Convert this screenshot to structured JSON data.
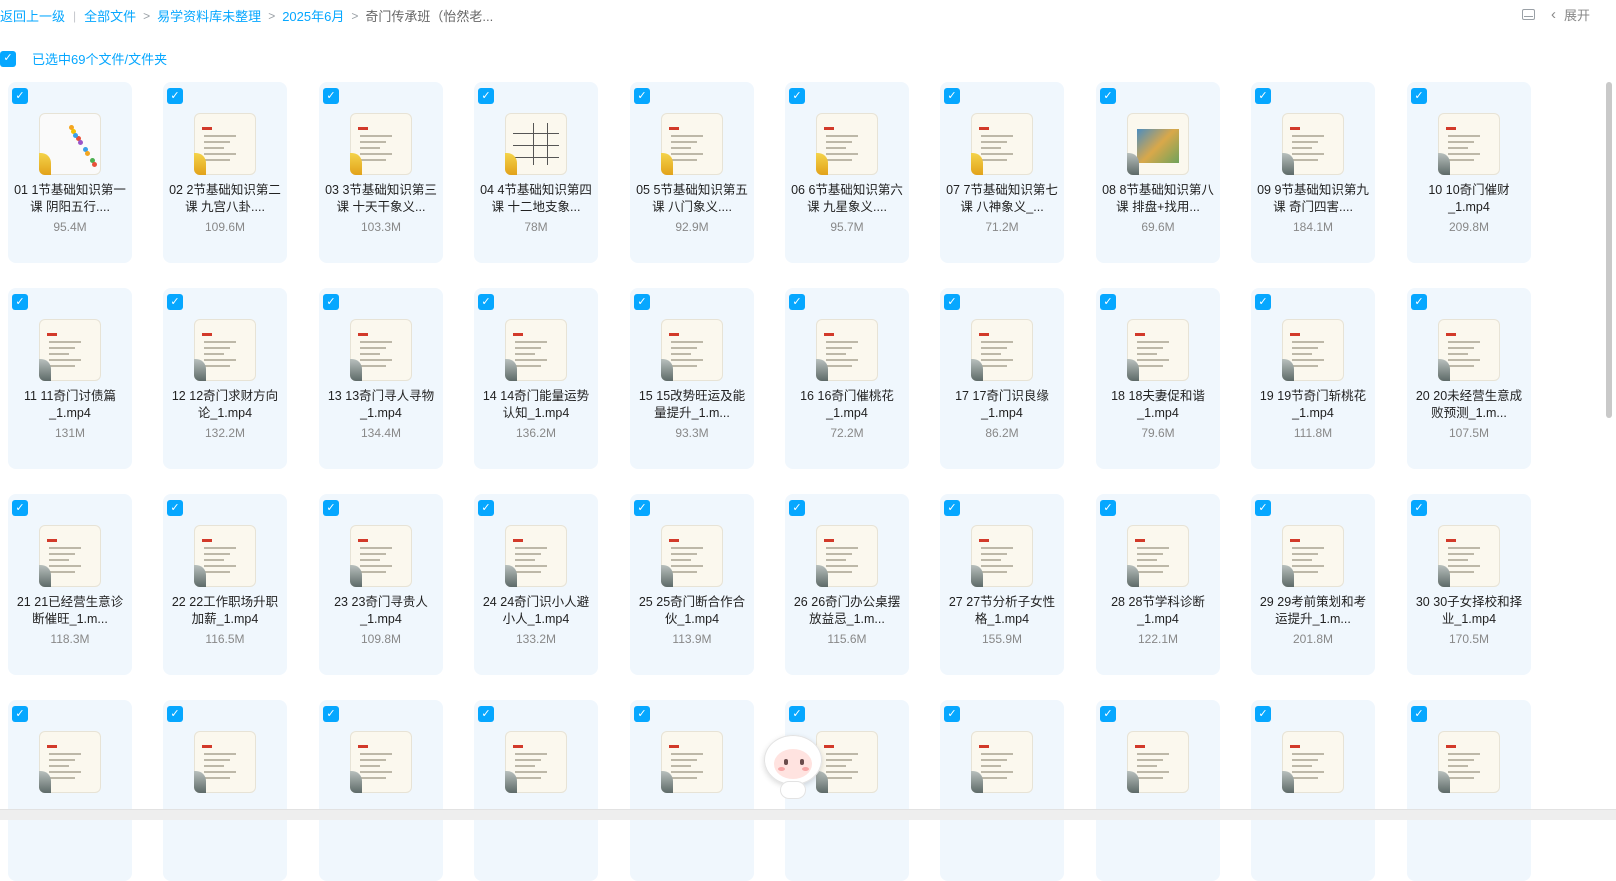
{
  "breadcrumb": {
    "back": "返回上一级",
    "root": "全部文件",
    "items": [
      "易学资料库未整理",
      "2025年6月"
    ],
    "current": "奇门传承班（怡然老..."
  },
  "toolbar": {
    "expand_label": "展开"
  },
  "selection": {
    "text": "已选中69个文件/文件夹"
  },
  "colors": {
    "accent": "#06a7ff",
    "card_bg": "#f0f7fd"
  },
  "files": [
    {
      "name": "01 1节基础知识第一课 阴阳五行....",
      "size": "95.4M"
    },
    {
      "name": "02 2节基础知识第二课 九宫八卦....",
      "size": "109.6M"
    },
    {
      "name": "03 3节基础知识第三课 十天干象义...",
      "size": "103.3M"
    },
    {
      "name": "04 4节基础知识第四课 十二地支象...",
      "size": "78M"
    },
    {
      "name": "05 5节基础知识第五课 八门象义....",
      "size": "92.9M"
    },
    {
      "name": "06 6节基础知识第六课 九星象义....",
      "size": "95.7M"
    },
    {
      "name": "07 7节基础知识第七课 八神象义_...",
      "size": "71.2M"
    },
    {
      "name": "08 8节基础知识第八课 排盘+找用...",
      "size": "69.6M"
    },
    {
      "name": "09 9节基础知识第九课 奇门四害....",
      "size": "184.1M"
    },
    {
      "name": "10 10奇门催财_1.mp4",
      "size": "209.8M"
    },
    {
      "name": "11 11奇门讨债篇_1.mp4",
      "size": "131M"
    },
    {
      "name": "12 12奇门求财方向论_1.mp4",
      "size": "132.2M"
    },
    {
      "name": "13 13奇门寻人寻物_1.mp4",
      "size": "134.4M"
    },
    {
      "name": "14 14奇门能量运势认知_1.mp4",
      "size": "136.2M"
    },
    {
      "name": "15 15改势旺运及能量提升_1.m...",
      "size": "93.3M"
    },
    {
      "name": "16 16奇门催桃花_1.mp4",
      "size": "72.2M"
    },
    {
      "name": "17 17奇门识良缘_1.mp4",
      "size": "86.2M"
    },
    {
      "name": "18 18夫妻促和谐_1.mp4",
      "size": "79.6M"
    },
    {
      "name": "19 19节奇门斩桃花_1.mp4",
      "size": "111.8M"
    },
    {
      "name": "20 20未经营生意成败预测_1.m...",
      "size": "107.5M"
    },
    {
      "name": "21 21已经营生意诊断催旺_1.m...",
      "size": "118.3M"
    },
    {
      "name": "22 22工作职场升职加薪_1.mp4",
      "size": "116.5M"
    },
    {
      "name": "23 23奇门寻贵人_1.mp4",
      "size": "109.8M"
    },
    {
      "name": "24 24奇门识小人避小人_1.mp4",
      "size": "133.2M"
    },
    {
      "name": "25 25奇门断合作合伙_1.mp4",
      "size": "113.9M"
    },
    {
      "name": "26 26奇门办公桌摆放益忌_1.m...",
      "size": "115.6M"
    },
    {
      "name": "27 27节分析子女性格_1.mp4",
      "size": "155.9M"
    },
    {
      "name": "28 28节学科诊断_1.mp4",
      "size": "122.1M"
    },
    {
      "name": "29 29考前策划和考运提升_1.m...",
      "size": "201.8M"
    },
    {
      "name": "30 30子女择校和择业_1.mp4",
      "size": "170.5M"
    },
    {
      "name": "",
      "size": ""
    },
    {
      "name": "",
      "size": ""
    },
    {
      "name": "",
      "size": ""
    },
    {
      "name": "",
      "size": ""
    },
    {
      "name": "",
      "size": ""
    },
    {
      "name": "",
      "size": ""
    },
    {
      "name": "",
      "size": ""
    },
    {
      "name": "",
      "size": ""
    },
    {
      "name": "",
      "size": ""
    },
    {
      "name": "",
      "size": ""
    }
  ]
}
